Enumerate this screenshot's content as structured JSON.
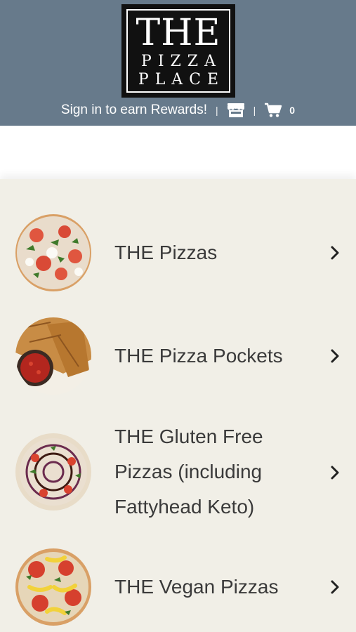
{
  "header": {
    "logo": {
      "line1": "THE",
      "line2": "PIZZA",
      "line3": "PLACE"
    },
    "signin_text": "Sign in to earn Rewards!",
    "separator": "|",
    "store_icon": "store-icon",
    "cart_icon": "cart-icon",
    "cart_count": "0",
    "background_color": "#677a8b"
  },
  "menu": {
    "background_color": "#f1efe7",
    "items": [
      {
        "label": "THE Pizzas",
        "icon": "chevron-right-icon",
        "image": "pizza-with-basil-and-tomato"
      },
      {
        "label": "THE Pizza Pockets",
        "icon": "chevron-right-icon",
        "image": "pizza-pockets-with-marinara"
      },
      {
        "label": "THE Gluten Free Pizzas (including Fattyhead Keto)",
        "icon": "chevron-right-icon",
        "image": "gluten-free-pizza-with-balsamic-drizzle"
      },
      {
        "label": "THE Vegan Pizzas",
        "icon": "chevron-right-icon",
        "image": "vegan-pizza-with-peppers"
      }
    ]
  }
}
